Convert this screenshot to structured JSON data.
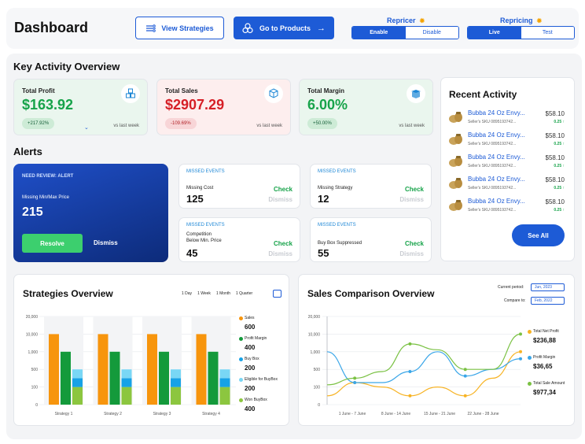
{
  "header": {
    "title": "Dashboard",
    "view_strategies": "View Strategies",
    "go_to_products": "Go to Products",
    "repricer": {
      "title": "Repricer",
      "options": [
        "Enable",
        "Disable"
      ],
      "selected": "Enable"
    },
    "repricing": {
      "title": "Repricing",
      "options": [
        "Live",
        "Test"
      ],
      "selected": "Live"
    }
  },
  "key_activity": {
    "title": "Key Activity Overview",
    "cards": [
      {
        "label": "Total Profit",
        "value": "$163.92",
        "change": "+217.92%",
        "vs": "vs last week",
        "value_color": "#17a34a"
      },
      {
        "label": "Total Sales",
        "value": "$2907.29",
        "change": "-109.69%",
        "vs": "vs last week",
        "value_color": "#d61f26"
      },
      {
        "label": "Total Margin",
        "value": "6.00%",
        "change": "+50.00%",
        "vs": "vs last week",
        "value_color": "#17a34a"
      }
    ]
  },
  "alerts": {
    "title": "Alerts",
    "review": {
      "heading": "NEED REVIEW: ALERT",
      "label": "Missing Min/Max Price",
      "value": "215",
      "resolve": "Resolve",
      "dismiss": "Dismiss"
    },
    "events": [
      {
        "heading": "MISSED EVENTS",
        "label": "Missing Cost",
        "value": "125",
        "check": "Check",
        "dismiss": "Dismiss"
      },
      {
        "heading": "MISSED EVENTS",
        "label": "Missing Strategy",
        "value": "12",
        "check": "Check",
        "dismiss": "Dismiss"
      },
      {
        "heading": "MISSED EVENTS",
        "label": "Competition Below Min. Price",
        "label_line1": "Competition",
        "label_line2": "Below Min. Price",
        "value": "45",
        "check": "Check",
        "dismiss": "Dismiss"
      },
      {
        "heading": "MISSED EVENTS",
        "label": "Buy Box Suppressed",
        "value": "55",
        "check": "Check",
        "dismiss": "Dismiss"
      }
    ]
  },
  "recent_activity": {
    "title": "Recent Activity",
    "items": [
      {
        "name": "Bubba 24 Oz Envy...",
        "sku": "Seller's SKU 0895193742...",
        "price": "$58.10",
        "change": "0.25"
      },
      {
        "name": "Bubba 24 Oz Envy...",
        "sku": "Seller's SKU 0895193742...",
        "price": "$58.10",
        "change": "0.25"
      },
      {
        "name": "Bubba 24 Oz Envy...",
        "sku": "Seller's SKU 0895193742...",
        "price": "$58.10",
        "change": "0.25"
      },
      {
        "name": "Bubba 24 Oz Envy...",
        "sku": "Seller's SKU 0895193742...",
        "price": "$58.10",
        "change": "0.25"
      },
      {
        "name": "Bubba 24 Oz Envy...",
        "sku": "Seller's SKU 0895193742...",
        "price": "$58.10",
        "change": "0.25"
      }
    ],
    "see_all": "See All"
  },
  "strategies_overview": {
    "title": "Strategies Overview",
    "ranges": [
      "1 Day",
      "1 Week",
      "1 Month",
      "1 Quarter"
    ],
    "legend": [
      {
        "name": "Sales",
        "value": "600",
        "color": "#f7950d"
      },
      {
        "name": "Profit Margin",
        "value": "400",
        "color": "#149a3b"
      },
      {
        "name": "Buy Box",
        "value": "200",
        "color": "#17a2e6"
      },
      {
        "name": "Eligible for BuyBox",
        "value": "200",
        "color": "#79d7f5"
      },
      {
        "name": "Won BuyBox",
        "value": "400",
        "color": "#8cc63f"
      }
    ]
  },
  "sales_comparison": {
    "title": "Sales Comparison Overview",
    "current_period_label": "Current period:",
    "current_period": "Jun, 2023",
    "compare_label": "Compare to:",
    "compare_period": "Feb, 2022",
    "legend": [
      {
        "name": "Total Net Profit",
        "value": "$236,88",
        "color": "#f7b324"
      },
      {
        "name": "Profit Margin",
        "value": "$36,65",
        "color": "#3aa6e8"
      },
      {
        "name": "Total Sale Amount",
        "value": "$977,34",
        "color": "#7ac143"
      }
    ]
  },
  "chart_data": [
    {
      "type": "bar",
      "title": "Strategies Overview",
      "categories": [
        "Strategy 1",
        "Strategy 2",
        "Strategy 3",
        "Strategy 4"
      ],
      "y_ticks": [
        "0",
        "100",
        "500",
        "1,000",
        "10,000",
        "20,000"
      ],
      "series": [
        {
          "name": "Sales",
          "values": [
            10000,
            10000,
            10000,
            10000
          ],
          "color": "#f7950d"
        },
        {
          "name": "Profit Margin",
          "values": [
            1000,
            1000,
            1000,
            1000
          ],
          "color": "#149a3b"
        },
        {
          "name": "Won BuyBox",
          "values": [
            100,
            100,
            100,
            100
          ],
          "color": "#8cc63f"
        },
        {
          "name": "Buy Box",
          "values": [
            300,
            300,
            300,
            300
          ],
          "color": "#17a2e6"
        },
        {
          "name": "Eligible for BuyBox",
          "values": [
            500,
            500,
            500,
            500
          ],
          "color": "#79d7f5"
        }
      ],
      "grid": true
    },
    {
      "type": "line",
      "title": "Sales Comparison Overview",
      "categories": [
        "1 June - 7 June",
        "8 June - 14 June",
        "15 June - 21 June",
        "22 June - 28 June"
      ],
      "y_ticks": [
        "0",
        "100",
        "500",
        "1,000",
        "10,000",
        "20,000"
      ],
      "series": [
        {
          "name": "Total Net Profit",
          "color": "#f7b324",
          "values": [
            50,
            200,
            100,
            50,
            100,
            50,
            300,
            1000
          ]
        },
        {
          "name": "Profit Margin",
          "color": "#3aa6e8",
          "values": [
            1000,
            200,
            200,
            450,
            1000,
            350,
            500,
            800
          ]
        },
        {
          "name": "Total Sale Amount",
          "color": "#7ac143",
          "values": [
            150,
            300,
            450,
            5000,
            2000,
            500,
            500,
            10000
          ]
        }
      ],
      "grid": true
    }
  ]
}
